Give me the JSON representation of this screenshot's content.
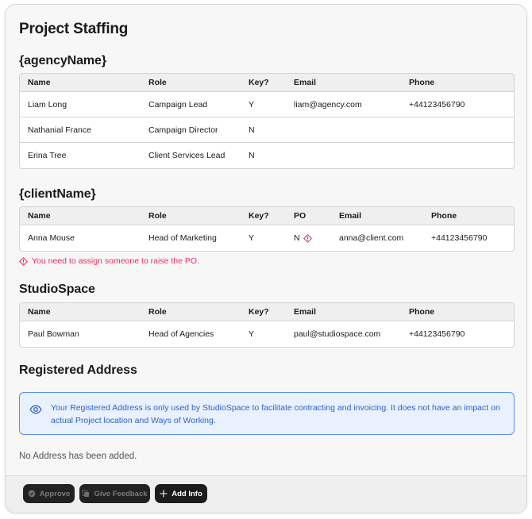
{
  "title": "Project Staffing",
  "agency": {
    "heading": "{agencyName}",
    "columns": [
      "Name",
      "Role",
      "Key?",
      "Email",
      "Phone"
    ],
    "rows": [
      {
        "name": "Liam Long",
        "role": "Campaign Lead",
        "key": "Y",
        "email": "liam@agency.com",
        "phone": "+44123456790"
      },
      {
        "name": "Nathanial France",
        "role": "Campaign Director",
        "key": "N",
        "email": "",
        "phone": ""
      },
      {
        "name": "Erina Tree",
        "role": "Client Services Lead",
        "key": "N",
        "email": "",
        "phone": ""
      }
    ]
  },
  "client": {
    "heading": "{clientName}",
    "columns": [
      "Name",
      "Role",
      "Key?",
      "PO",
      "Email",
      "Phone"
    ],
    "rows": [
      {
        "name": "Anna Mouse",
        "role": "Head of Marketing",
        "key": "Y",
        "po": "N",
        "email": "anna@client.com",
        "phone": "+44123456790"
      }
    ],
    "error": "You need to assign someone to raise the PO."
  },
  "studio": {
    "heading": "StudioSpace",
    "columns": [
      "Name",
      "Role",
      "Key?",
      "Email",
      "Phone"
    ],
    "rows": [
      {
        "name": "Paul Bowman",
        "role": "Head of Agencies",
        "key": "Y",
        "email": "paul@studiospace.com",
        "phone": "+44123456790"
      }
    ]
  },
  "address": {
    "heading": "Registered Address",
    "info": "Your Registered Address is only used by StudioSpace to facilitate contracting and invoicing. It does not have an impact on actual Project location and Ways of Working.",
    "empty": "No Address has been added."
  },
  "footer": {
    "approve": "Approve",
    "feedback": "Give Feedback",
    "add_info": "Add Info"
  },
  "colors": {
    "error": "#e0315a",
    "info_bg": "#e8f1fd",
    "info_border": "#5b8ee6",
    "info_text": "#2f5fc8",
    "button_bg": "#1c1c1c"
  },
  "icons": [
    "warning-icon",
    "eye-icon",
    "check-circle-icon",
    "feedback-icon",
    "plus-icon"
  ]
}
